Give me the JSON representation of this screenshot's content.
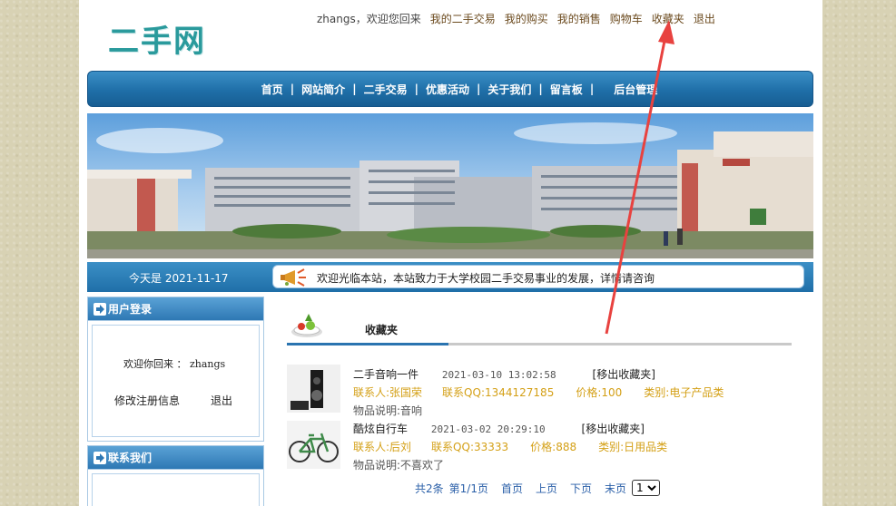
{
  "header": {
    "logo_text": "二手网",
    "welcome": "zhangs，欢迎您回来",
    "links": [
      "我的二手交易",
      "我的购买",
      "我的销售",
      "购物车",
      "收藏夹",
      "退出"
    ]
  },
  "mainnav": {
    "items": [
      "首页",
      "网站简介",
      "二手交易",
      "优惠活动",
      "关于我们",
      "留言板"
    ],
    "last": "后台管理",
    "separator": "|"
  },
  "datebar": {
    "date": "今天是 2021-11-17",
    "marquee": "欢迎光临本站，本站致力于大学校园二手交易事业的发展，详情请咨询"
  },
  "sidebar": {
    "login_title": "用户登录",
    "welcome": "欢迎你回来 ： zhangs",
    "edit_link": "修改注册信息",
    "logout_link": "退出",
    "contact_title": "联系我们"
  },
  "content": {
    "title": "收藏夹",
    "items": [
      {
        "name": "二手音响一件",
        "time": "2021-03-10 13:02:58",
        "remove": "[移出收藏夹]",
        "contact": "联系人:张国荣",
        "qq": "联系QQ:1344127185",
        "price": "价格:100",
        "category": "类别:电子产品类",
        "desc": "物品说明:音响"
      },
      {
        "name": "酷炫自行车",
        "time": "2021-03-02 20:29:10",
        "remove": "[移出收藏夹]",
        "contact": "联系人:后刘",
        "qq": "联系QQ:33333",
        "price": "价格:888",
        "category": "类别:日用品类",
        "desc": "物品说明:不喜欢了"
      }
    ],
    "pager": {
      "total": "共2条",
      "page": "第1/1页",
      "first": "首页",
      "prev": "上页",
      "next": "下页",
      "last": "末页",
      "select_value": "1"
    }
  },
  "colors": {
    "nav_blue": "#1f6fa8",
    "info_gold": "#d4a017",
    "link_brown": "#6b4a1e",
    "annotation_red": "#e8423f",
    "logo_teal": "#2a9a9c"
  }
}
